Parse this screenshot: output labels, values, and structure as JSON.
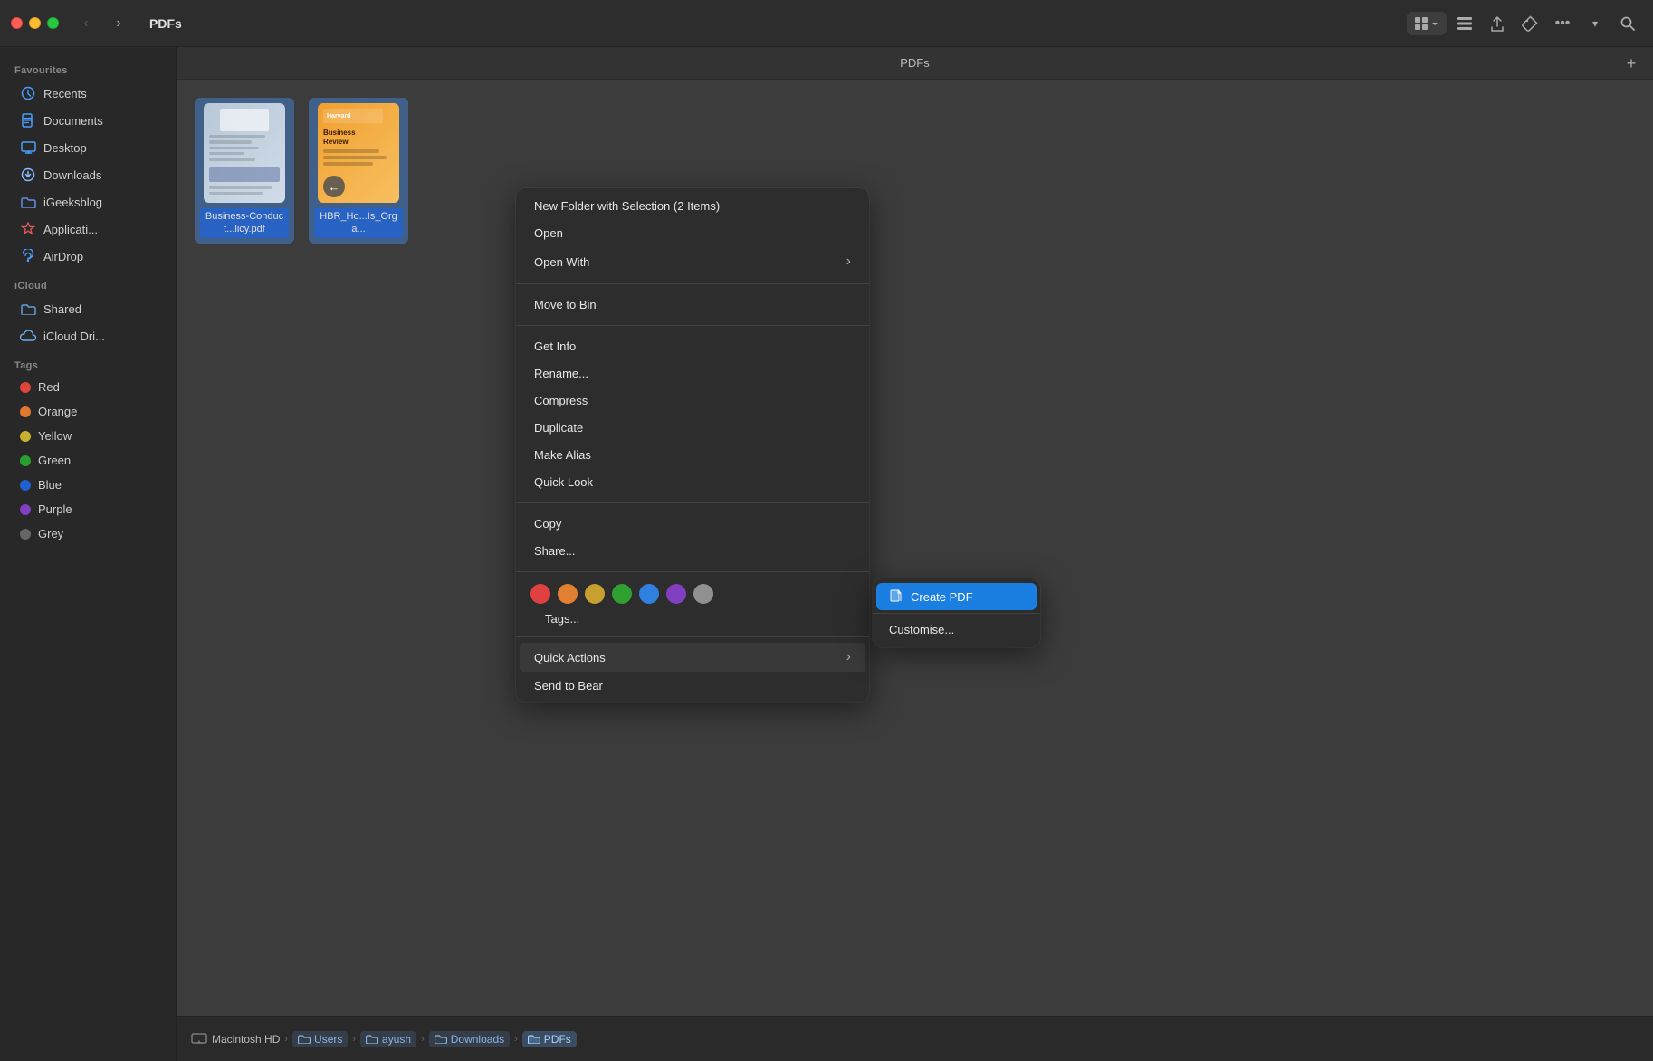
{
  "titlebar": {
    "back_btn": "‹",
    "forward_btn": "›",
    "title": "PDFs",
    "view_grid": "⊞",
    "view_options": "⊟"
  },
  "sidebar": {
    "favourites_header": "Favourites",
    "items_favourites": [
      {
        "id": "recents",
        "icon": "🕐",
        "label": "Recents",
        "icon_class": "icon-recents"
      },
      {
        "id": "documents",
        "icon": "📄",
        "label": "Documents",
        "icon_class": "icon-documents"
      },
      {
        "id": "desktop",
        "icon": "🖥",
        "label": "Desktop",
        "icon_class": "icon-desktop"
      },
      {
        "id": "downloads",
        "icon": "⬇",
        "label": "Downloads",
        "icon_class": "icon-downloads"
      },
      {
        "id": "igeeksblog",
        "icon": "📁",
        "label": "iGeeksblog",
        "icon_class": "icon-igeeks"
      },
      {
        "id": "applications",
        "icon": "🚀",
        "label": "Applicati...",
        "icon_class": "icon-applications"
      },
      {
        "id": "airdrop",
        "icon": "📡",
        "label": "AirDrop",
        "icon_class": "icon-airdrop"
      }
    ],
    "icloud_header": "iCloud",
    "items_icloud": [
      {
        "id": "shared",
        "icon": "📂",
        "label": "Shared",
        "icon_class": "icon-shared"
      },
      {
        "id": "icloud-drive",
        "icon": "☁",
        "label": "iCloud Dri...",
        "icon_class": "icon-icloud-drive"
      }
    ],
    "tags_header": "Tags",
    "tags": [
      {
        "id": "red",
        "color": "#e0453a",
        "label": "Red"
      },
      {
        "id": "orange",
        "color": "#e07830",
        "label": "Orange"
      },
      {
        "id": "yellow",
        "color": "#c8b030",
        "label": "Yellow"
      },
      {
        "id": "green",
        "color": "#28a030",
        "label": "Green"
      },
      {
        "id": "blue",
        "color": "#2060d0",
        "label": "Blue"
      },
      {
        "id": "purple",
        "color": "#8040c0",
        "label": "Purple"
      },
      {
        "id": "grey",
        "color": "#666666",
        "label": "Grey"
      }
    ]
  },
  "content": {
    "header_title": "PDFs",
    "files": [
      {
        "id": "file1",
        "name": "Business-Conduct...licy.pdf",
        "selected": true,
        "cover_type": "blue"
      },
      {
        "id": "file2",
        "name": "HBR_Ho...Is_Orga...",
        "selected": true,
        "cover_type": "orange"
      }
    ]
  },
  "context_menu": {
    "new_folder": "New Folder with Selection (2 Items)",
    "open": "Open",
    "open_with": "Open With",
    "move_to_bin": "Move to Bin",
    "get_info": "Get Info",
    "rename": "Rename...",
    "compress": "Compress",
    "duplicate": "Duplicate",
    "make_alias": "Make Alias",
    "quick_look": "Quick Look",
    "copy": "Copy",
    "share": "Share...",
    "tags_label": "Tags...",
    "tag_colors": [
      {
        "id": "red",
        "color": "#e04040"
      },
      {
        "id": "orange",
        "color": "#e08030"
      },
      {
        "id": "yellow",
        "color": "#c8a030"
      },
      {
        "id": "green",
        "color": "#30a030"
      },
      {
        "id": "blue",
        "color": "#3080e0"
      },
      {
        "id": "purple",
        "color": "#8040c0"
      },
      {
        "id": "grey",
        "color": "#909090"
      }
    ],
    "quick_actions": "Quick Actions",
    "send_to_bear": "Send to Bear"
  },
  "quick_actions_submenu": {
    "create_pdf": "Create PDF",
    "customise": "Customise..."
  },
  "status_bar": {
    "macintosh_hd": "Macintosh HD",
    "users": "Users",
    "ayush": "ayush",
    "downloads": "Downloads",
    "pdfs": "PDFs"
  }
}
